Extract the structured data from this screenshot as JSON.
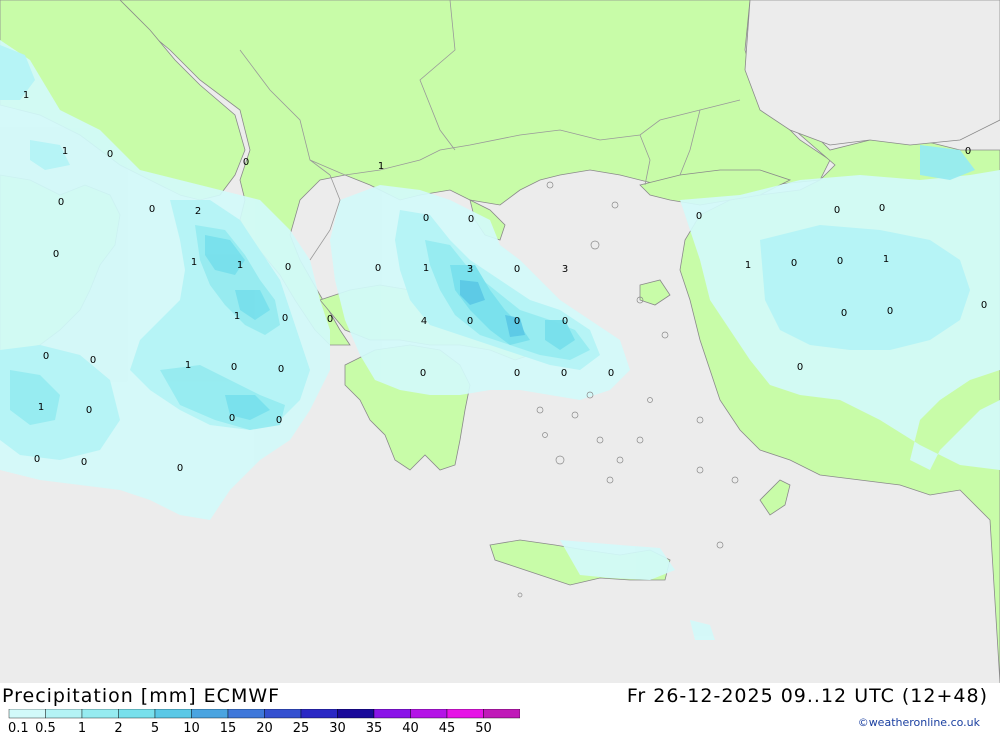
{
  "header": {
    "title": "Precipitation [mm] ECMWF",
    "datetime": "Fr 26-12-2025 09..12 UTC (12+48)",
    "credit": "©weatheronline.co.uk"
  },
  "colors": {
    "sea": "#ececec",
    "land": "#c8fca8",
    "border": "#999999",
    "coast": "#8a8a8a"
  },
  "legend": {
    "labels": [
      "0.1",
      "0.5",
      "1",
      "2",
      "5",
      "10",
      "15",
      "20",
      "25",
      "30",
      "35",
      "40",
      "45",
      "50"
    ],
    "colors": [
      "#d2fafa",
      "#b4f3f5",
      "#96ebf0",
      "#78e0ec",
      "#5ac8e6",
      "#4aa4e0",
      "#3f78da",
      "#3450d0",
      "#2a28c4",
      "#1a0a9a",
      "#8a14e8",
      "#b414e6",
      "#e614e6",
      "#c01ab8",
      "#a01ea0"
    ]
  },
  "values": [
    "1",
    "1",
    "0",
    "0",
    "0",
    "2",
    "0",
    "1",
    "1",
    "0",
    "1",
    "0",
    "0",
    "0",
    "0",
    "1",
    "0",
    "0",
    "1",
    "0",
    "0",
    "0",
    "0",
    "0",
    "0",
    "0",
    "1",
    "0",
    "3",
    "0",
    "0",
    "1",
    "0",
    "3",
    "4",
    "0",
    "0",
    "0",
    "0",
    "0",
    "0",
    "0",
    "0",
    "0",
    "0",
    "0",
    "1",
    "0",
    "0",
    "1",
    "0",
    "0",
    "0",
    "0"
  ]
}
